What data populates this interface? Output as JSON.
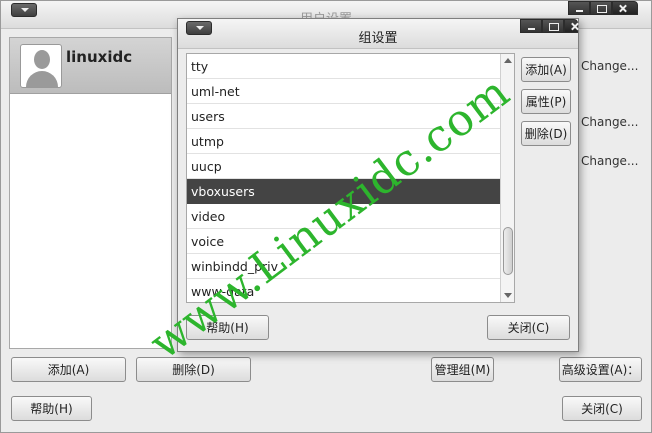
{
  "main_window": {
    "title": "用户设置",
    "user": {
      "name": "linuxidc"
    },
    "change_links": [
      "Change...",
      "Change...",
      "Change..."
    ],
    "buttons": {
      "add": "添加(A)",
      "delete": "删除(D)",
      "manage_groups": "管理组(M)",
      "advanced": "高级设置(A)：",
      "help": "帮助(H)",
      "close": "关闭(C)"
    }
  },
  "dialog": {
    "title": "组设置",
    "groups": [
      "tty",
      "uml-net",
      "users",
      "utmp",
      "uucp",
      "vboxusers",
      "video",
      "voice",
      "winbindd_priv",
      "www-data"
    ],
    "selected_group": "vboxusers",
    "buttons": {
      "add": "添加(A)",
      "properties": "属性(P)",
      "delete": "删除(D)",
      "help": "帮助(H)",
      "close": "关闭(C)"
    }
  },
  "watermark": "www.Linuxidc.com",
  "colors": {
    "watermark": "#2db52d",
    "selection": "#444444"
  }
}
